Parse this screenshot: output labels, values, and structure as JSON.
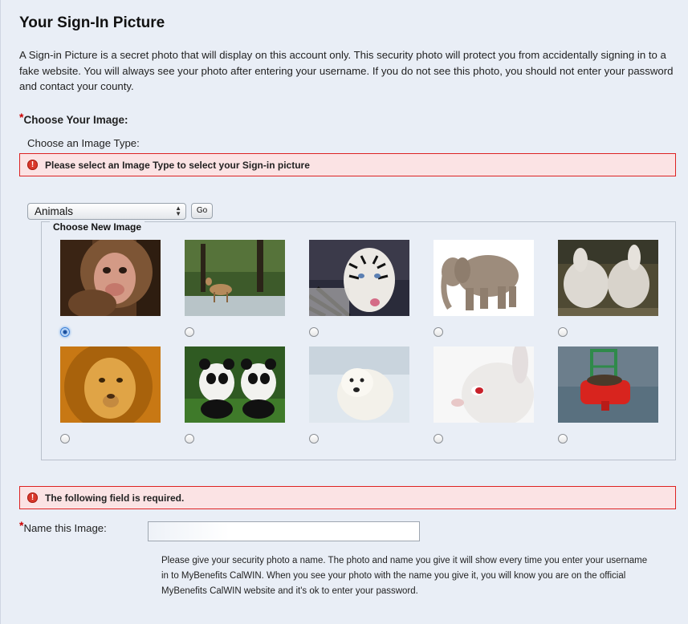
{
  "page_title": "Your Sign-In Picture",
  "intro_text": "A Sign-in Picture is a secret photo that will display on this account only. This security photo will protect you from accidentally signing in to a fake website. You will always see your photo after entering your username. If you do not see this photo, you should not enter your password and contact your county.",
  "required_marker": "*",
  "choose_image_label": "Choose Your Image:",
  "image_type_label": "Choose an Image Type:",
  "errors": {
    "image_type": "Please select an Image Type to select your Sign-in picture",
    "field_required": "The following field is required."
  },
  "image_type_select": {
    "selected": "Animals"
  },
  "go_button": "Go",
  "image_group_legend": "Choose New Image",
  "images": [
    {
      "subject": "monkey",
      "selected": true
    },
    {
      "subject": "deer",
      "selected": false
    },
    {
      "subject": "white tiger",
      "selected": false
    },
    {
      "subject": "elephant",
      "selected": false
    },
    {
      "subject": "white horses",
      "selected": false
    },
    {
      "subject": "lion",
      "selected": false
    },
    {
      "subject": "pandas",
      "selected": false
    },
    {
      "subject": "polar bear",
      "selected": false
    },
    {
      "subject": "white rabbit",
      "selected": false
    },
    {
      "subject": "sea lion on red buoy",
      "selected": false
    }
  ],
  "name_field": {
    "label": "Name this Image:",
    "value": "",
    "placeholder": ""
  },
  "help_text": "Please give your security photo a name. The photo and name you give it will show every time you enter your username in to MyBenefits CalWIN. When you see your photo with the name you give it, you will know you are on the official MyBenefits CalWIN website and it's ok to enter your password."
}
